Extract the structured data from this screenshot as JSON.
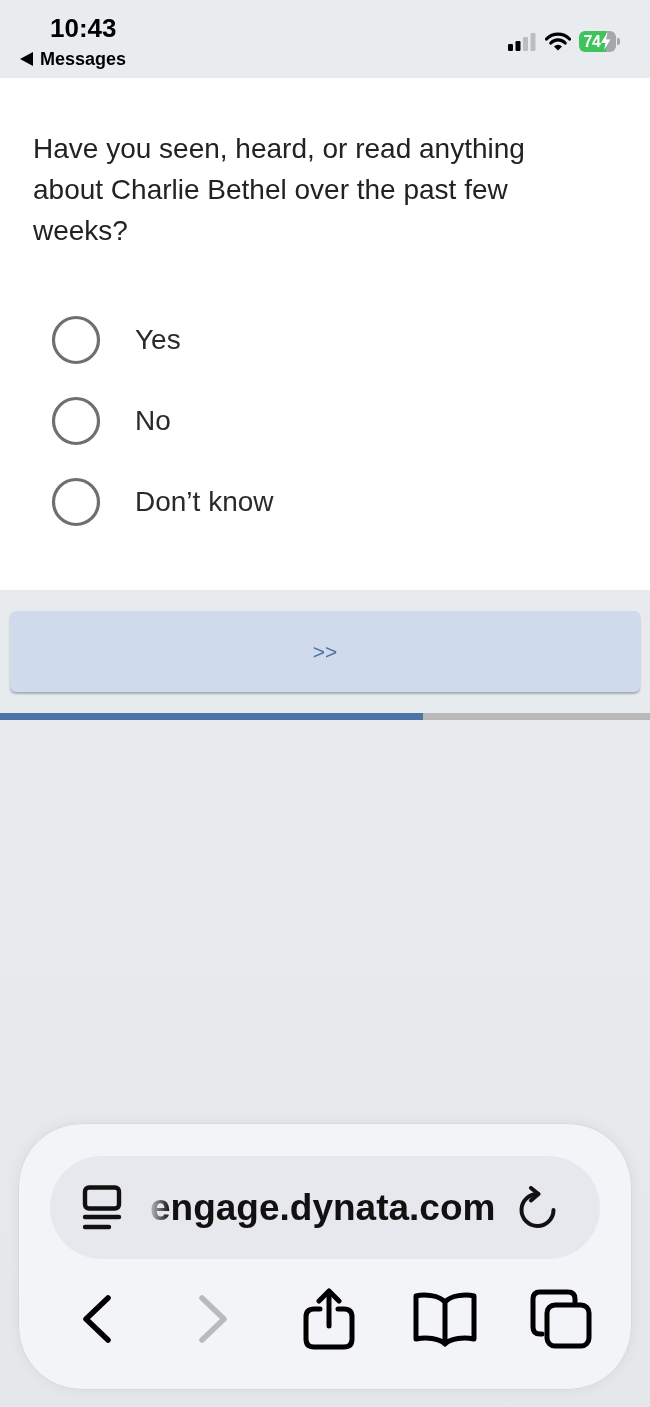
{
  "status_bar": {
    "time": "10:43",
    "back_label": "Messages",
    "battery": "74",
    "charging": true
  },
  "question": {
    "text": "Have you seen, heard, or read anything about Charlie Bethel over the past few weeks?",
    "options": [
      {
        "label": "Yes",
        "selected": false
      },
      {
        "label": "No",
        "selected": false
      },
      {
        "label": "Don’t know",
        "selected": false
      }
    ]
  },
  "next_button": {
    "label": ">>"
  },
  "progress": {
    "level": 0.65
  },
  "browser": {
    "url": "engage.dynata.com",
    "toolbar": [
      {
        "kind": "back",
        "disabled": false
      },
      {
        "kind": "forward",
        "disabled": true
      },
      {
        "kind": "share",
        "disabled": false
      },
      {
        "kind": "bookmarks",
        "disabled": false
      },
      {
        "kind": "tabs",
        "disabled": false
      }
    ]
  }
}
